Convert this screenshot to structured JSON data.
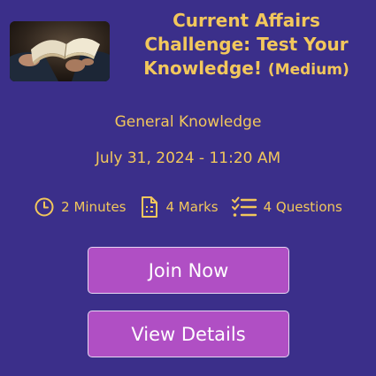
{
  "quiz": {
    "title": "Current Affairs Challenge: Test Your Knowledge!",
    "level": "(Medium)",
    "category": "General Knowledge",
    "datetime": "July 31, 2024 - 11:20 AM",
    "thumbnail_icon": "open-book-reading-photo"
  },
  "meta": {
    "duration": "2 Minutes",
    "marks": "4 Marks",
    "questions": "4 Questions",
    "duration_icon": "clock-icon",
    "marks_icon": "document-icon",
    "questions_icon": "checklist-icon"
  },
  "actions": {
    "join_label": "Join Now",
    "details_label": "View Details"
  },
  "colors": {
    "background": "#3b2f8a",
    "accent_text": "#f2c75c",
    "button": "#b04fc4"
  }
}
